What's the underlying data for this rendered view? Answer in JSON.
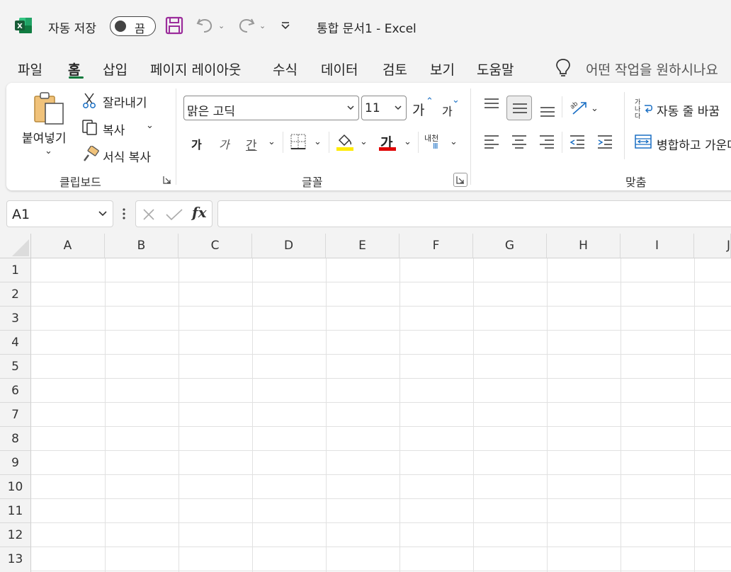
{
  "titlebar": {
    "autosave_label": "자동 저장",
    "autosave_state": "끔",
    "doc_title": "통합 문서1  -  Excel"
  },
  "menu": {
    "items": [
      "파일",
      "홈",
      "삽입",
      "페이지 레이아웃",
      "수식",
      "데이터",
      "검토",
      "보기",
      "도움말"
    ],
    "active": "홈",
    "search_placeholder": "어떤 작업을 원하시나요"
  },
  "ribbon": {
    "clipboard": {
      "paste": "붙여넣기",
      "cut": "잘라내기",
      "copy": "복사",
      "format_painter": "서식 복사",
      "label": "클립보드"
    },
    "font": {
      "font_name": "맑은 고딕",
      "font_size": "11",
      "grow_glyph": "가",
      "shrink_glyph": "가",
      "bold": "가",
      "italic": "가",
      "underline": "간",
      "font_color_glyph": "가",
      "phonetic_glyph": "내천",
      "label": "글꼴",
      "highlight_color": "#ffeb00",
      "font_color": "#e00000"
    },
    "alignment": {
      "wrap_glyph": "가나다",
      "wrap": "자동 줄 바꿈",
      "merge": "병합하고 가운데 맞춤",
      "label": "맞춤"
    }
  },
  "formula_bar": {
    "name_box": "A1",
    "fx": "fx",
    "value": ""
  },
  "grid": {
    "columns": [
      "A",
      "B",
      "C",
      "D",
      "E",
      "F",
      "G",
      "H",
      "I",
      "J"
    ],
    "rows": [
      "1",
      "2",
      "3",
      "4",
      "5",
      "6",
      "7",
      "8",
      "9",
      "10",
      "11",
      "12",
      "13"
    ]
  },
  "colors": {
    "accent": "#117a3d",
    "excel_green": "#107c41"
  }
}
